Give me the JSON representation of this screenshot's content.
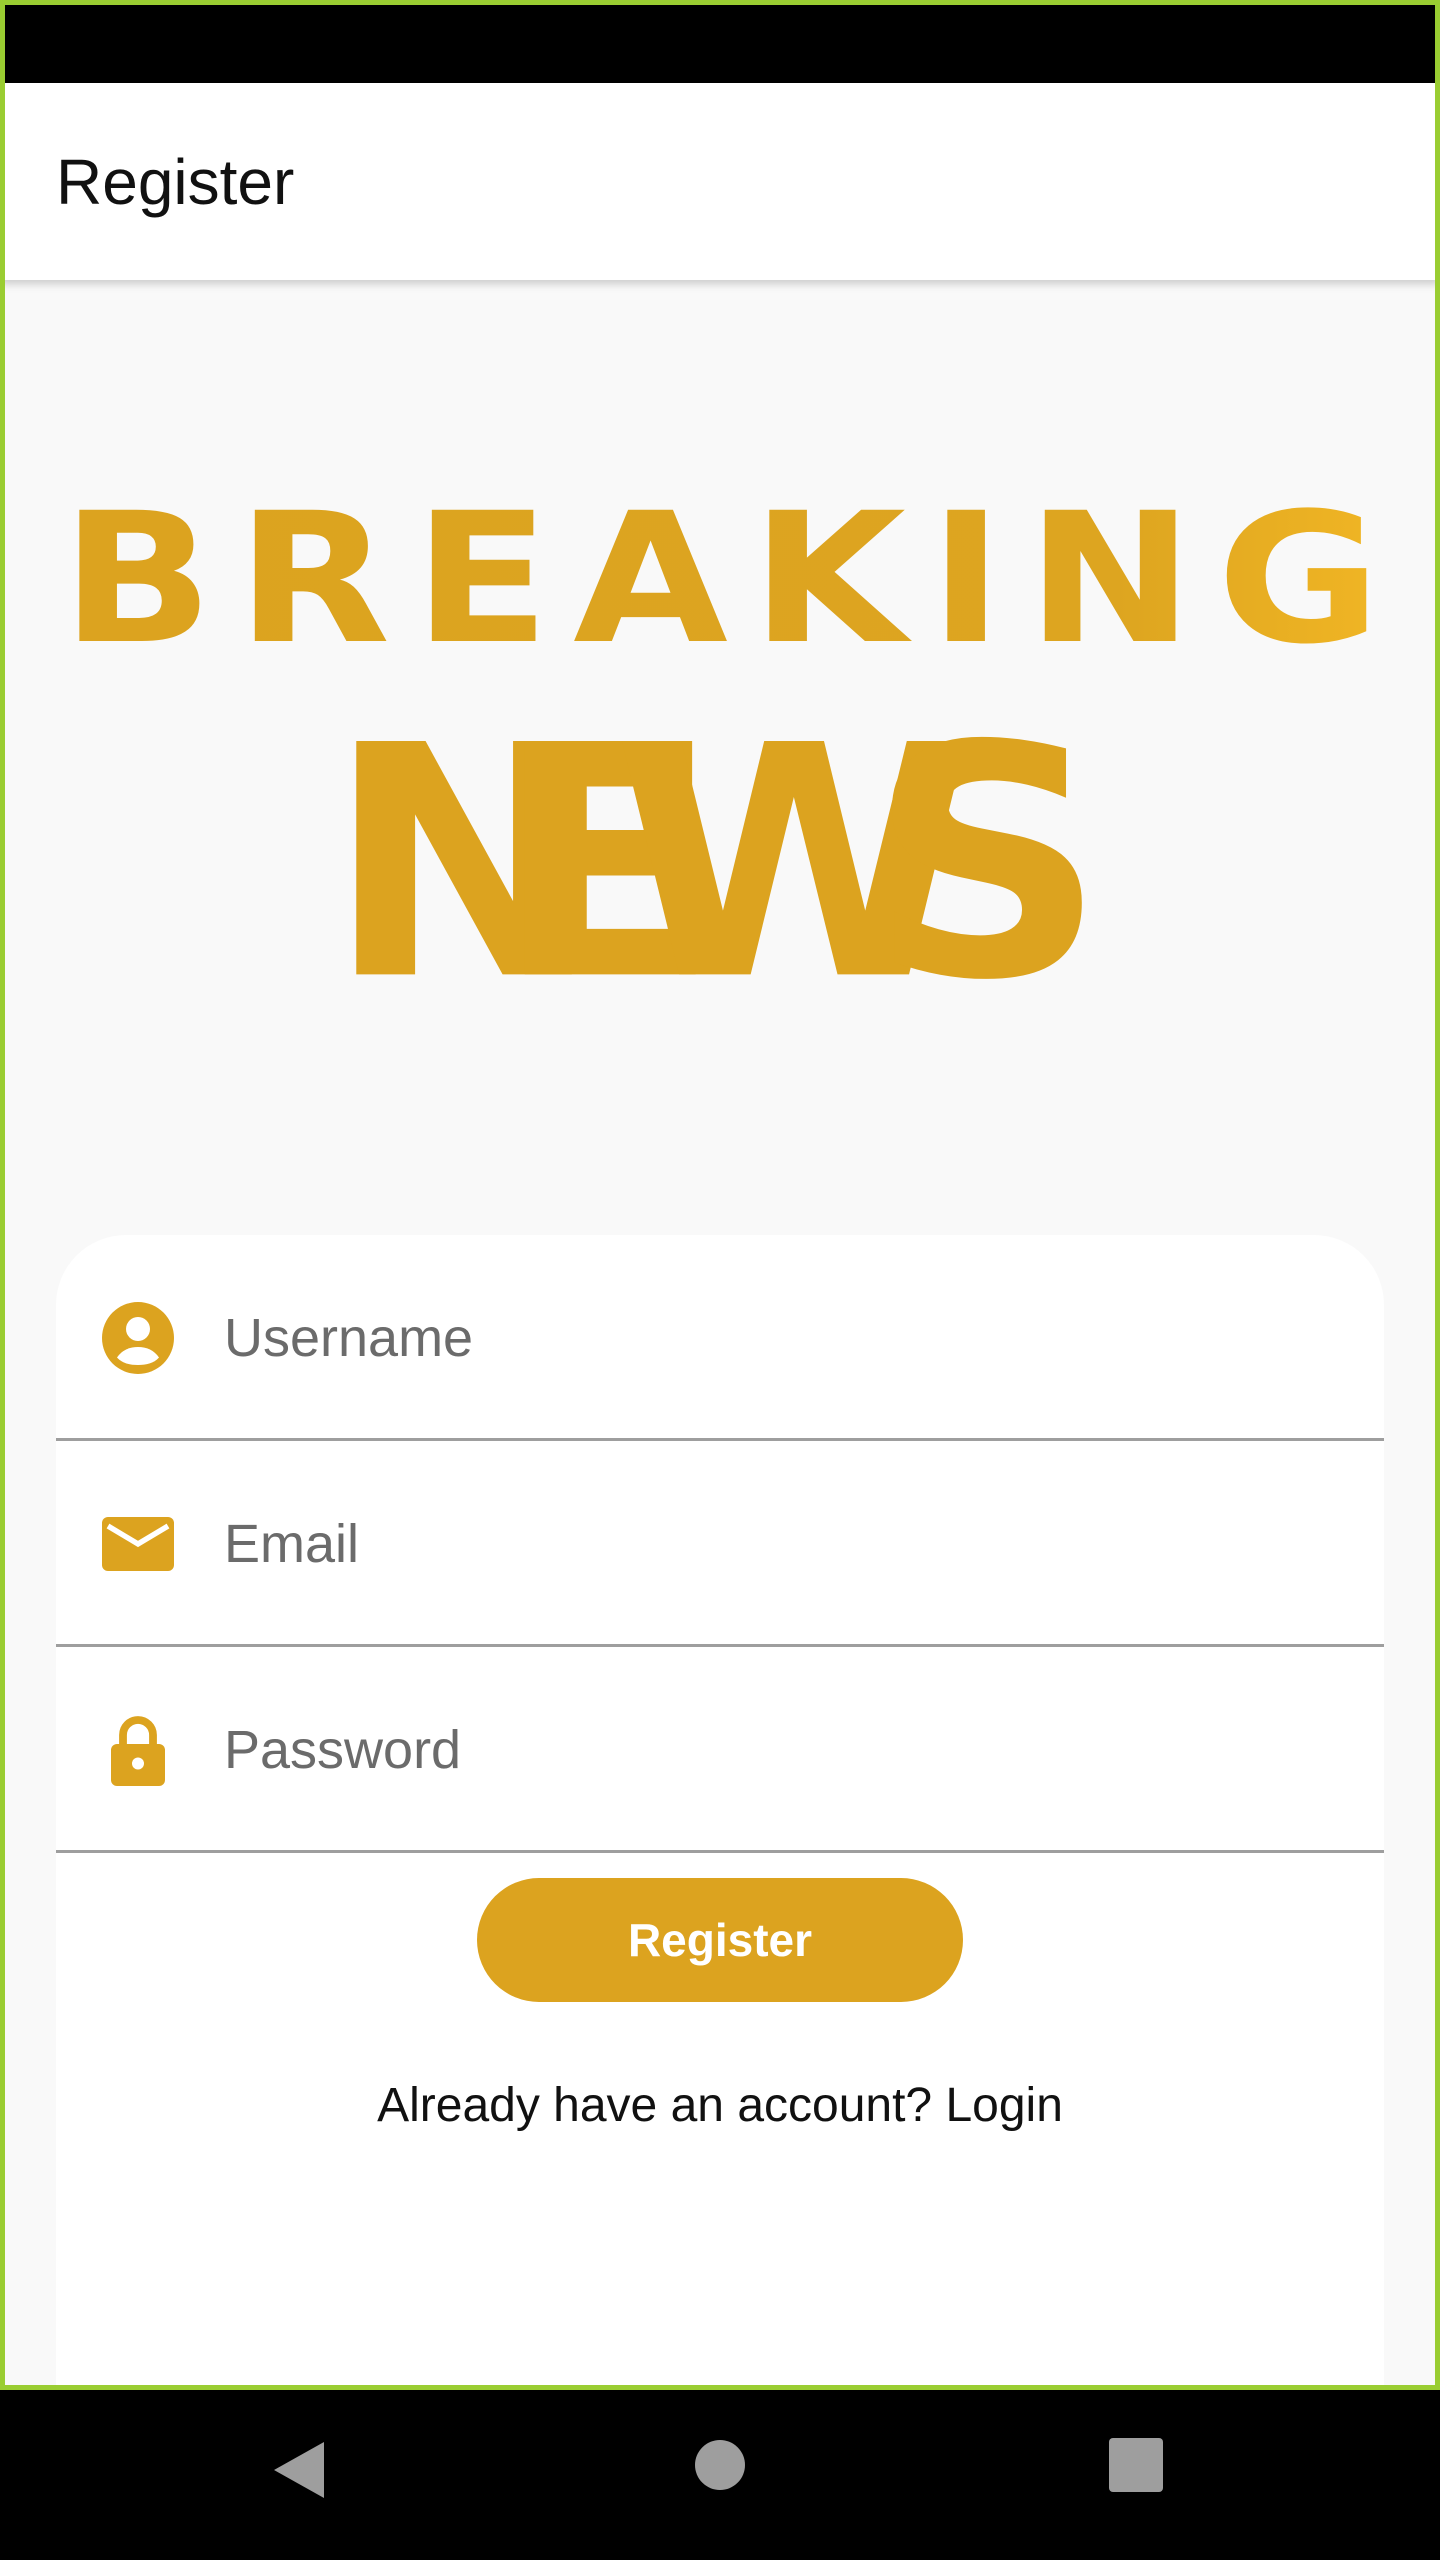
{
  "app_bar": {
    "title": "Register"
  },
  "logo": {
    "line1": "BREAKING",
    "line2": "NEWS",
    "color": "#dca31f"
  },
  "form": {
    "username": {
      "placeholder": "Username",
      "value": "",
      "icon": "account-circle-icon"
    },
    "email": {
      "placeholder": "Email",
      "value": "",
      "icon": "email-icon"
    },
    "password": {
      "placeholder": "Password",
      "value": "",
      "icon": "lock-icon"
    },
    "register_label": "Register",
    "login_prompt": "Already have an account? Login"
  },
  "colors": {
    "accent": "#dca31f",
    "frame": "#9acd32"
  },
  "nav": {
    "back_icon": "back-triangle-icon",
    "home_icon": "home-circle-icon",
    "recents_icon": "recents-square-icon"
  }
}
